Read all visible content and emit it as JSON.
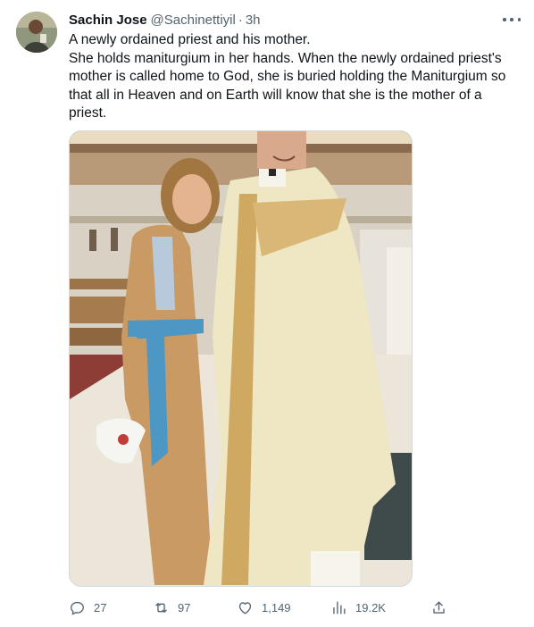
{
  "tweet": {
    "author_name": "Sachin Jose",
    "author_handle": "@Sachinettiyil",
    "separator": "·",
    "time": "3h",
    "text_lines": [
      "A newly ordained priest and his mother.",
      "She holds maniturgium in her hands. When the newly ordained priest's mother is called home to God, she is buried holding the Maniturgium so that all in Heaven and on Earth will know that she is the mother of a priest."
    ],
    "icons": {
      "more": "more-horizontal-icon",
      "reply": "reply-icon",
      "retweet": "retweet-icon",
      "like": "heart-icon",
      "views": "views-icon",
      "share": "share-icon"
    },
    "stats": {
      "replies": "27",
      "retweets": "97",
      "likes": "1,149",
      "views": "19.2K"
    },
    "colors": {
      "text": "#0f1419",
      "secondary": "#536471",
      "border": "#cfd9de"
    }
  }
}
